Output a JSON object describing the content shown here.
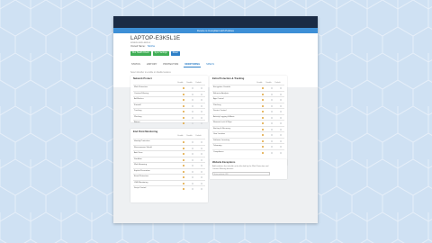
{
  "colors": {
    "background": "#cfe1f3",
    "pattern": "#e4eefa",
    "topbar": "#1a2b45",
    "notice": "#3d8fd6",
    "accent": "#2d7fc7",
    "green": "#3fae55",
    "dot_on": "#e0a43a"
  },
  "notice_text": "Device is Compliant with Policies",
  "device": {
    "name": "LAPTOP-E3K5L1E",
    "id_line": "xxxxxx-xxxx-xxxx-x",
    "owner_label": "Owned Name:",
    "owner_value": "Tabitha"
  },
  "actions": [
    "Run Health Check",
    "Sync Settings",
    "Reset"
  ],
  "tabs": [
    "STATUS",
    "HISTORY",
    "PROTECTION",
    "MONITORING",
    "SPECS"
  ],
  "active_tab": "MONITORING",
  "hint": "Select whether to enable or disable features",
  "columns": [
    "Enable",
    "Disable",
    "Default"
  ],
  "panels": {
    "network": {
      "title": "Network Protect",
      "rows": [
        {
          "label": "Web Protection",
          "on": 0
        },
        {
          "label": "Content Filtering",
          "on": 0
        },
        {
          "label": "Ad Blocker",
          "on": 0
        },
        {
          "label": "Firewall",
          "on": 0
        },
        {
          "label": "Tracking",
          "on": 0
        },
        {
          "label": "Phishing",
          "on": 0
        },
        {
          "label": "Botnet",
          "on": 0
        }
      ]
    },
    "endpoint": {
      "title": "End Point Monitoring",
      "rows": [
        {
          "label": "Identity Protection",
          "on": 0
        },
        {
          "label": "Ransomware Shield",
          "on": 0
        },
        {
          "label": "Anti-Virus",
          "on": 0
        },
        {
          "label": "Sandbox",
          "on": 0
        },
        {
          "label": "Web Browsing",
          "on": 0
        },
        {
          "label": "Exploit Prevention",
          "on": 0
        },
        {
          "label": "Email Protection",
          "on": 0
        },
        {
          "label": "USB Monitoring",
          "on": 0
        },
        {
          "label": "Script Control",
          "on": 0
        }
      ]
    },
    "extra": {
      "title": "Extra Protection & Tracking",
      "rows": [
        {
          "label": "Encryption Controls",
          "on": 0
        },
        {
          "label": "Behavior Analysis",
          "on": 0
        },
        {
          "label": "App Control",
          "on": 0
        },
        {
          "label": "Patching",
          "on": 0
        },
        {
          "label": "Device Control",
          "on": 0
        },
        {
          "label": "Activity Logging & Alerts",
          "on": 0
        },
        {
          "label": "Remote Lock & Wipe",
          "on": 0
        },
        {
          "label": "Backup & Recovery",
          "on": 0
        },
        {
          "label": "Geo Location",
          "on": 0
        },
        {
          "label": "Software Inventory",
          "on": 0
        },
        {
          "label": "Telemetry",
          "on": 0
        },
        {
          "label": "Compliance",
          "on": 0
        }
      ]
    },
    "exceptions": {
      "title": "Website Exceptions",
      "description": "Add websites that should not be blocked by the Web Protection and Content Filtering features",
      "placeholder": "Enter website URL"
    }
  }
}
